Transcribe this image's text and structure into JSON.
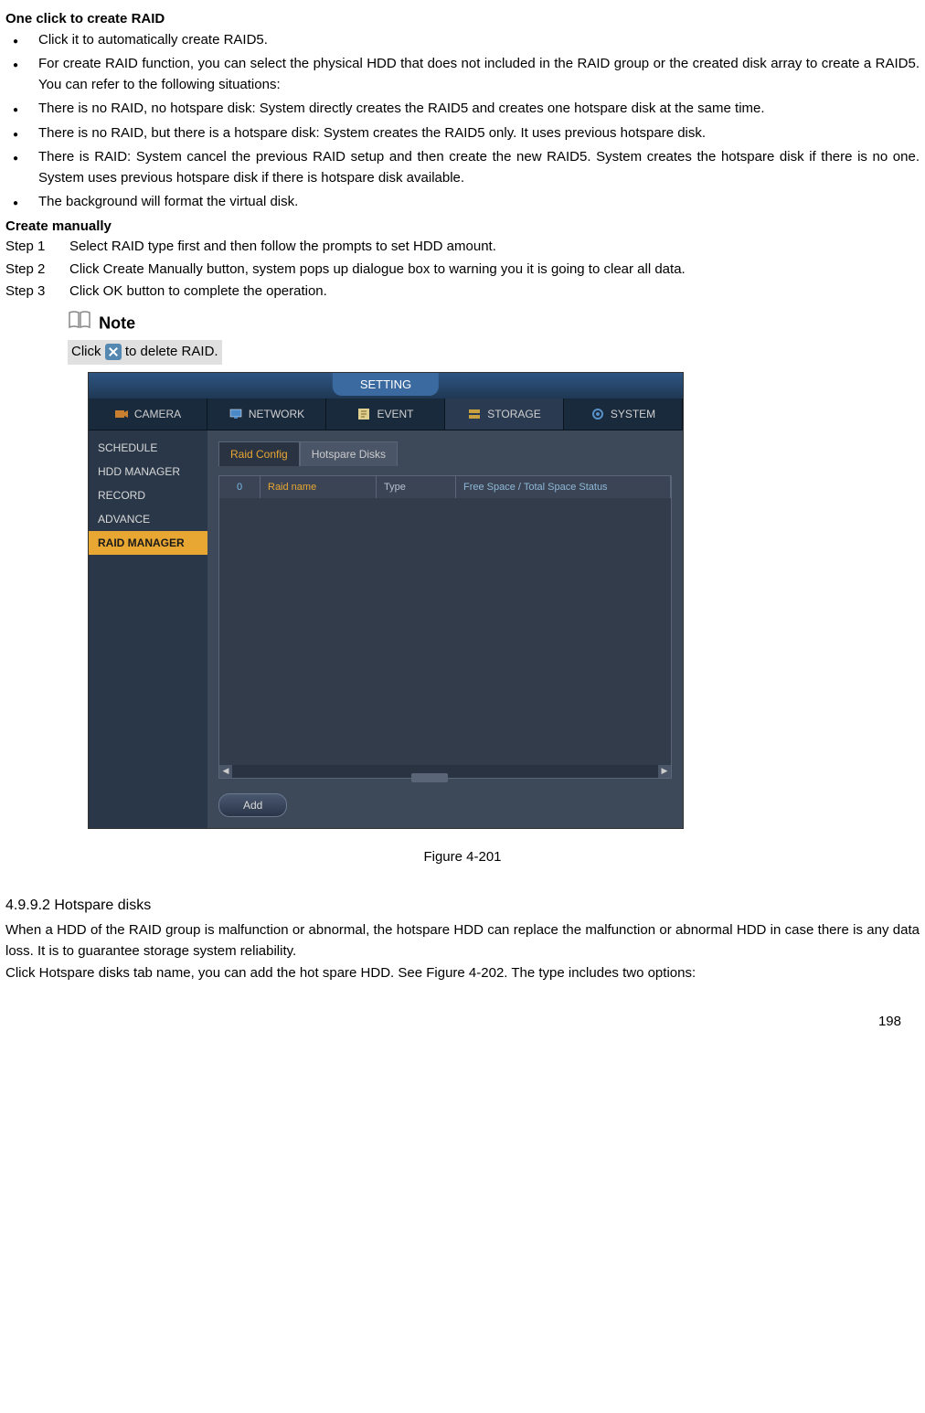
{
  "headings": {
    "one_click": "One click to create RAID",
    "create_manually": "Create manually",
    "section_4992": "4.9.9.2  Hotspare disks"
  },
  "bullets": [
    "Click it to automatically create RAID5.",
    "For create RAID function, you can select the physical HDD that does not included in the RAID group or the created disk array to create a RAID5. You can refer to the following situations:",
    "There is no RAID, no hotspare disk: System directly creates the RAID5 and creates one hotspare disk at the same time.",
    "There is no RAID, but there is a hotspare disk: System creates the RAID5 only. It uses previous hotspare disk.",
    "There is RAID: System cancel the previous RAID setup and then create the new RAID5. System creates the hotspare disk if there is no one. System uses previous hotspare disk if there is hotspare disk available.",
    "The background will format the virtual disk."
  ],
  "steps": [
    {
      "label": "Step 1",
      "text": "Select RAID type first and then follow the prompts to set HDD amount."
    },
    {
      "label": "Step 2",
      "text": "Click Create Manually button, system pops up dialogue box to warning you it is going to clear all data."
    },
    {
      "label": "Step 3",
      "text": "Click OK button to complete the operation."
    }
  ],
  "note": {
    "label": "Note",
    "prefix": "Click ",
    "suffix": " to delete RAID."
  },
  "screenshot": {
    "title": "SETTING",
    "nav": [
      "CAMERA",
      "NETWORK",
      "EVENT",
      "STORAGE",
      "SYSTEM"
    ],
    "nav_active_index": 3,
    "sidebar": [
      "SCHEDULE",
      "HDD MANAGER",
      "RECORD",
      "ADVANCE",
      "RAID MANAGER"
    ],
    "sidebar_active_index": 4,
    "tabs": [
      "Raid Config",
      "Hotspare Disks"
    ],
    "tab_active_index": 0,
    "table_headers": {
      "count": "0",
      "name": "Raid name",
      "type": "Type",
      "space": "Free Space / Total Space Status"
    },
    "add_button": "Add"
  },
  "figure_caption": "Figure 4-201",
  "hotspare_paragraphs": [
    "When a HDD of the RAID group is malfunction or abnormal, the hotspare HDD can replace the malfunction or abnormal HDD in case there is any data loss. It is to guarantee storage system reliability.",
    "Click Hotspare disks tab name, you can add the hot spare HDD. See Figure 4-202. The type includes two options:"
  ],
  "page_number": "198"
}
